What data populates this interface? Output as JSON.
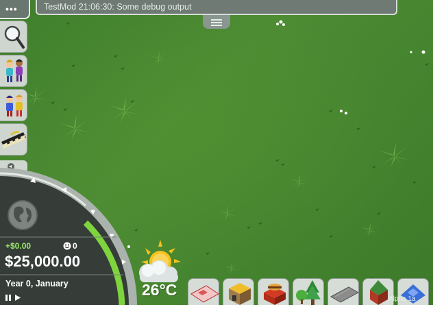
{
  "console": {
    "message": "TestMod 21:06:30: Some debug output"
  },
  "menu": {
    "dots": "•••"
  },
  "sidebar": {
    "items": [
      {
        "name": "search-tool",
        "icon": "magnifier-icon"
      },
      {
        "name": "guests",
        "icon": "guests-icon"
      },
      {
        "name": "staff",
        "icon": "staff-icon"
      },
      {
        "name": "rides",
        "icon": "ride-train-icon"
      }
    ]
  },
  "finance": {
    "income": "+$0.00",
    "guests": "0",
    "money": "$25,000.00",
    "date": "Year 0, January"
  },
  "weather": {
    "temperature": "26°C"
  },
  "toolbar": {
    "items": [
      {
        "name": "terrain",
        "icon": "terrain-icon"
      },
      {
        "name": "shops",
        "icon": "shop-icon"
      },
      {
        "name": "food",
        "icon": "burger-stall-icon"
      },
      {
        "name": "scenery",
        "icon": "tree-icon"
      },
      {
        "name": "paths",
        "icon": "path-icon"
      },
      {
        "name": "buildings",
        "icon": "building-icon"
      },
      {
        "name": "blueprints",
        "icon": "blueprint-icon"
      }
    ]
  },
  "version": "Alpha 1a",
  "colors": {
    "grass": "#4a8a32",
    "panel": "#6f7a74",
    "income": "#9be86b",
    "meter": "#7ed43d"
  }
}
